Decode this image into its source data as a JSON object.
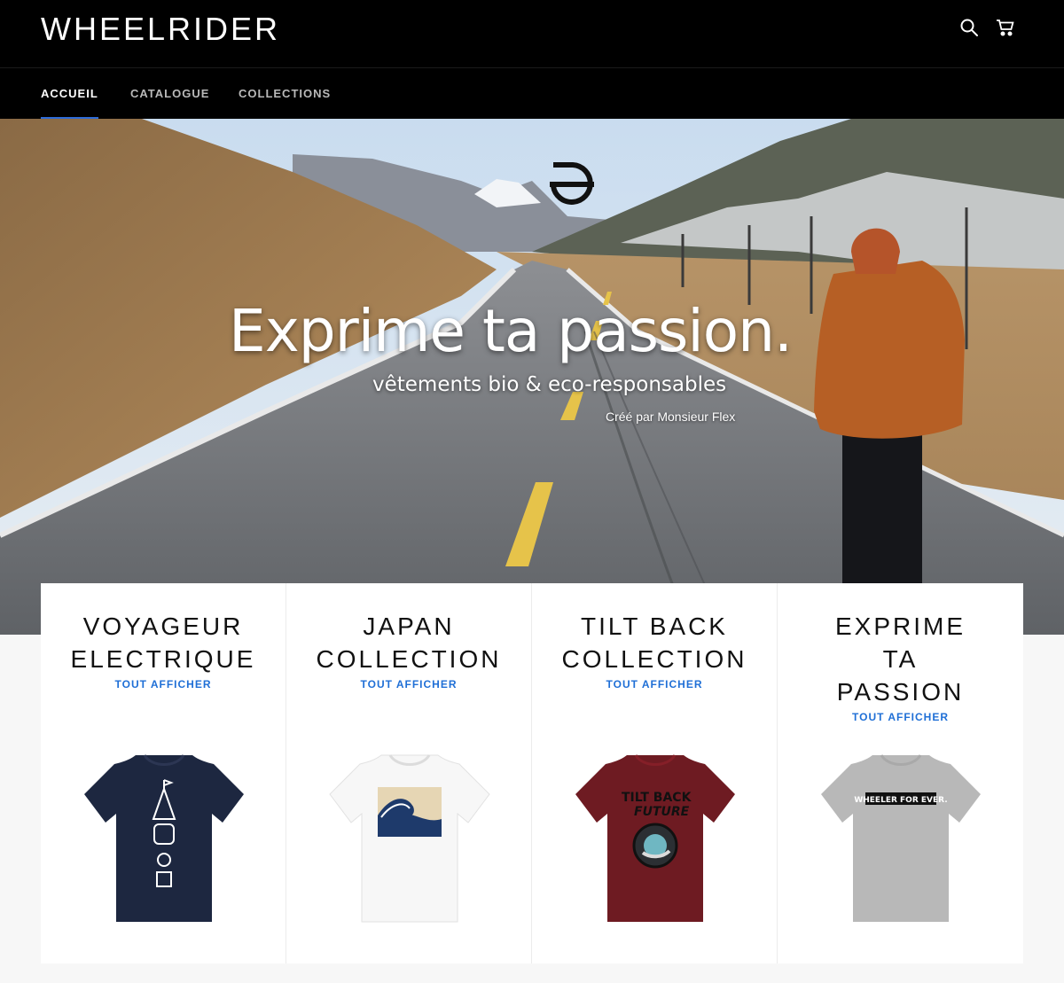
{
  "header": {
    "logo": "WHEELRIDER",
    "icons": [
      "search-icon",
      "cart-icon"
    ]
  },
  "nav": {
    "items": [
      {
        "label": "ACCUEIL",
        "active": true
      },
      {
        "label": "CATALOGUE",
        "active": false
      },
      {
        "label": "COLLECTIONS",
        "active": false
      }
    ]
  },
  "hero": {
    "title": "Exprime ta passion.",
    "subtitle": "vêtements bio & eco-responsables",
    "credit": "Créé par Monsieur Flex"
  },
  "collections": [
    {
      "title_lines": [
        "VOYAGEUR",
        "ELECTRIQUE"
      ],
      "link": "TOUT AFFICHER",
      "shirt_color": "#1d2740",
      "print": "tower"
    },
    {
      "title_lines": [
        "JAPAN",
        "COLLECTION"
      ],
      "link": "TOUT AFFICHER",
      "shirt_color": "#f7f7f7",
      "print": "wave"
    },
    {
      "title_lines": [
        "TILT BACK",
        "COLLECTION"
      ],
      "link": "TOUT AFFICHER",
      "shirt_color": "#6e1b22",
      "print_text": [
        "TILT BACK",
        "FUTURE"
      ]
    },
    {
      "title_lines": [
        "EXPRIME",
        "TA",
        "PASSION"
      ],
      "link": "TOUT AFFICHER",
      "shirt_color": "#b8b8b8",
      "print_text": [
        "WHEELER FOR EVER."
      ]
    }
  ],
  "colors": {
    "header_bg": "#000000",
    "nav_accent": "#2d6bd8",
    "link": "#1f6fd6"
  }
}
